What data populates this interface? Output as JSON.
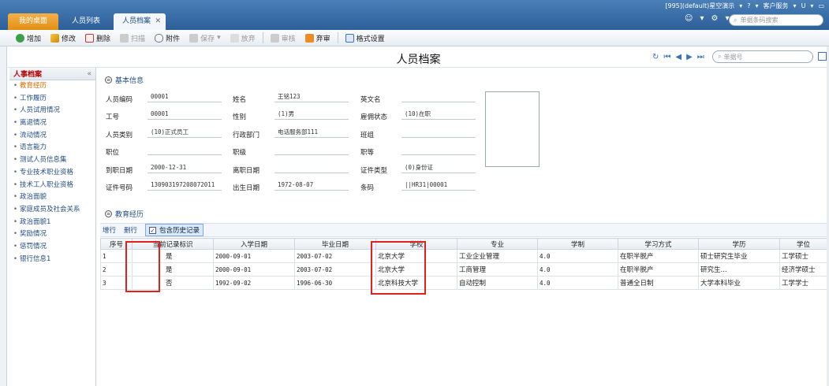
{
  "system": {
    "account": "[995](default)星空演示",
    "service": "客户服务",
    "u_label": "U"
  },
  "tabs": [
    {
      "label": "我的桌面"
    },
    {
      "label": "人员列表"
    },
    {
      "label": "人员档案"
    }
  ],
  "quick_search": {
    "placeholder": "单据条码搜索"
  },
  "toolbar": {
    "add": "增加",
    "edit": "修改",
    "delete": "删除",
    "scan": "扫描",
    "attach": "附件",
    "save": "保存",
    "discard": "放弃",
    "audit": "审核",
    "abandon": "弃审",
    "format": "格式设置"
  },
  "page": {
    "title": "人员档案",
    "bill_search_placeholder": "单据号"
  },
  "sidebar": {
    "title": "人事档案",
    "collapse": "«",
    "items": [
      "教育经历",
      "工作履历",
      "人员试用情况",
      "离退情况",
      "流动情况",
      "语言能力",
      "测试人员信息集",
      "专业技术职业资格",
      "技术工人职业资格",
      "政治面貌",
      "家庭成员及社会关系",
      "政治面貌1",
      "奖励情况",
      "惩罚情况",
      "银行信息1"
    ]
  },
  "basic_info": {
    "section_title": "基本信息",
    "fields": {
      "emp_code": {
        "label": "人员编码",
        "value": "00001"
      },
      "name": {
        "label": "姓名",
        "value": "王铭123"
      },
      "english_name": {
        "label": "英文名",
        "value": ""
      },
      "job_no": {
        "label": "工号",
        "value": "00001"
      },
      "gender": {
        "label": "性别",
        "value": "(1)男"
      },
      "employ_status": {
        "label": "雇佣状态",
        "value": "(10)在职"
      },
      "emp_type": {
        "label": "人员类别",
        "value": "(10)正式员工"
      },
      "dept": {
        "label": "行政部门",
        "value": "电话服务部111"
      },
      "team": {
        "label": "班组",
        "value": ""
      },
      "position": {
        "label": "职位",
        "value": ""
      },
      "rank": {
        "label": "职级",
        "value": ""
      },
      "grade": {
        "label": "职等",
        "value": ""
      },
      "join_date": {
        "label": "到职日期",
        "value": "2000-12-31"
      },
      "leave_date": {
        "label": "离职日期",
        "value": ""
      },
      "id_type": {
        "label": "证件类型",
        "value": "(0)身份证"
      },
      "id_no": {
        "label": "证件号码",
        "value": "130903197208072011"
      },
      "birth": {
        "label": "出生日期",
        "value": "1972-08-07"
      },
      "barcode": {
        "label": "条码",
        "value": "||HR31|00001"
      }
    }
  },
  "education": {
    "section_title": "教育经历",
    "add_row": "增行",
    "delete_row": "删行",
    "history_toggle": "包含历史记录",
    "columns": [
      "序号",
      "当前记录标识",
      "入学日期",
      "毕业日期",
      "学校",
      "专业",
      "学制",
      "学习方式",
      "学历",
      "学位"
    ],
    "rows": [
      [
        "1",
        "是",
        "2000-09-01",
        "2003-07-02",
        "北京大学",
        "工业企业管理",
        "4.0",
        "在职半脱产",
        "硕士研究生毕业",
        "工学硕士"
      ],
      [
        "2",
        "是",
        "2000-09-01",
        "2003-07-02",
        "北京大学",
        "工商管理",
        "4.0",
        "在职半脱产",
        "研究生...",
        "经济学硕士"
      ],
      [
        "3",
        "否",
        "1992-09-02",
        "1996-06-30",
        "北京科技大学",
        "自动控制",
        "4.0",
        "普通全日制",
        "大学本科毕业",
        "工学学士"
      ]
    ]
  },
  "colors": {
    "accent": "#2d5f99",
    "highlight": "#e0221f",
    "active_tab": "#e48f15"
  }
}
